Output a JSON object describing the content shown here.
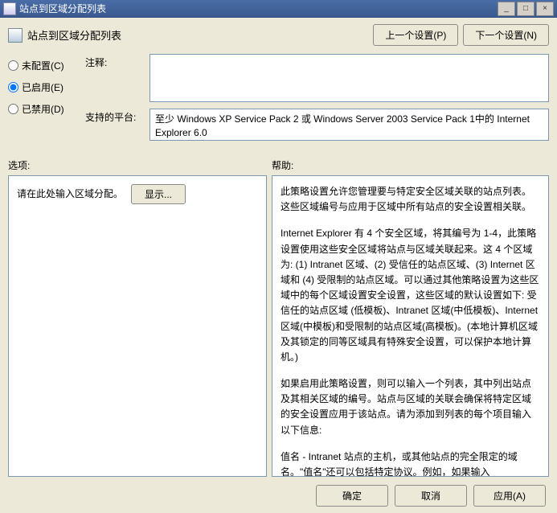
{
  "window": {
    "title": "站点到区域分配列表"
  },
  "header": {
    "title": "站点到区域分配列表",
    "prev_button": "上一个设置(P)",
    "next_button": "下一个设置(N)"
  },
  "radios": {
    "not_configured": "未配置(C)",
    "enabled": "已启用(E)",
    "disabled": "已禁用(D)",
    "selected": "enabled"
  },
  "fields": {
    "comment_label": "注释:",
    "comment_value": "",
    "platform_label": "支持的平台:",
    "platform_value": "至少 Windows XP Service Pack 2 或 Windows Server 2003 Service Pack 1中的 Internet Explorer 6.0"
  },
  "section_labels": {
    "options": "选项:",
    "help": "帮助:"
  },
  "options_panel": {
    "prompt": "请在此处输入区域分配。",
    "show_button": "显示..."
  },
  "help_panel": {
    "p1": "此策略设置允许您管理要与特定安全区域关联的站点列表。这些区域编号与应用于区域中所有站点的安全设置相关联。",
    "p2": "Internet Explorer 有 4 个安全区域，将其编号为 1-4，此策略设置使用这些安全区域将站点与区域关联起来。这 4 个区域为: (1) Intranet 区域、(2) 受信任的站点区域、(3) Internet 区域和 (4) 受限制的站点区域。可以通过其他策略设置为这些区域中的每个区域设置安全设置，这些区域的默认设置如下: 受信任的站点区域 (低模板)、Intranet 区域(中低模板)、Internet 区域(中模板)和受限制的站点区域(高模板)。(本地计算机区域及其锁定的同等区域具有特殊安全设置，可以保护本地计算机。)",
    "p3": "如果启用此策略设置，则可以输入一个列表，其中列出站点及其相关区域的编号。站点与区域的关联会确保将特定区域的安全设置应用于该站点。请为添加到列表的每个项目输入以下信息:",
    "p4": "值名 - Intranet 站点的主机，或其他站点的完全限定的域名。\"值名\"还可以包括特定协议。例如，如果输入 http://www.contoso.com 作为\"值名\"，则不会影响其他协议。"
  },
  "footer": {
    "ok": "确定",
    "cancel": "取消",
    "apply": "应用(A)"
  }
}
